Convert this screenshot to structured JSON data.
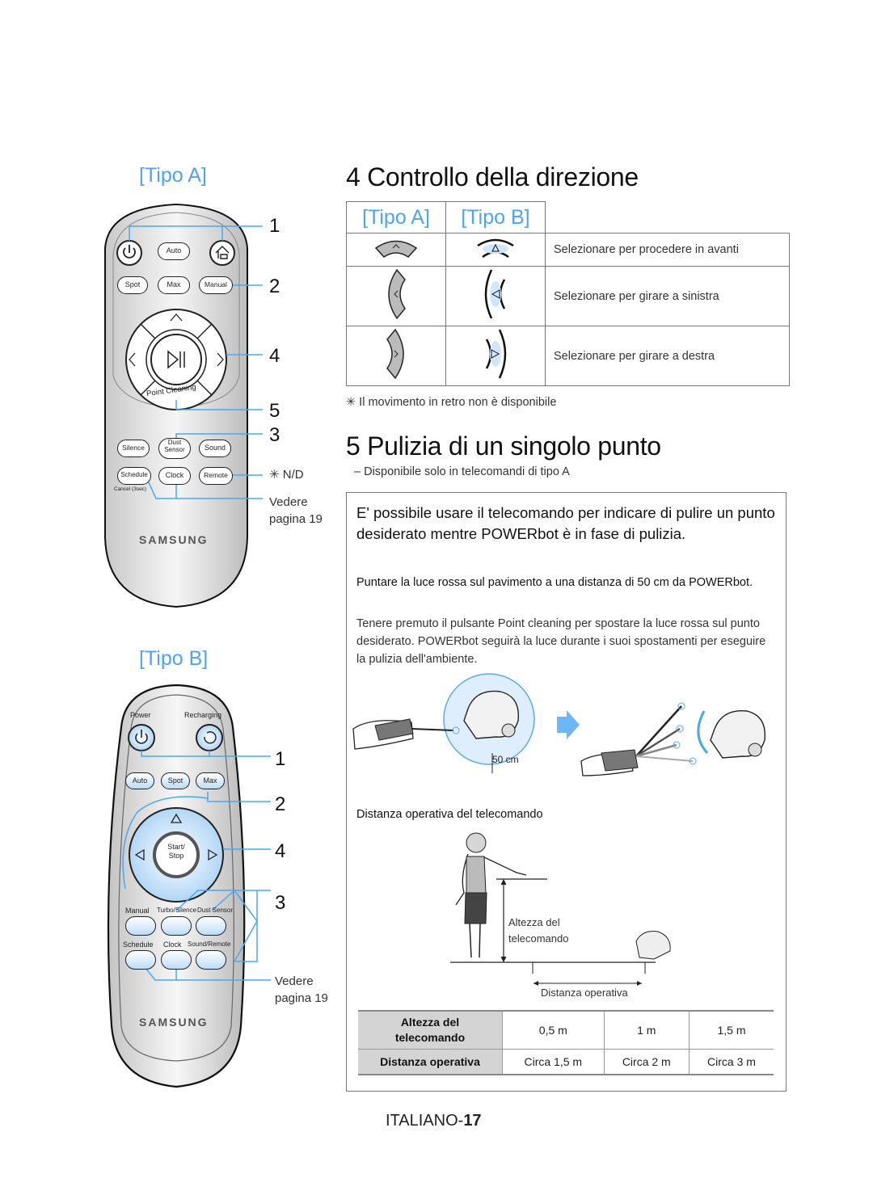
{
  "left": {
    "tipo_a_title": "[Tipo A]",
    "tipo_b_title": "[Tipo B]",
    "remote_a": {
      "buttons": {
        "power": "power-icon",
        "auto": "Auto",
        "recharge": "home-recharge-icon",
        "spot": "Spot",
        "max": "Max",
        "manual": "Manual",
        "play_pause": "play-pause-icon",
        "point_cleaning": "Point Cleaning",
        "silence": "Silence",
        "dust_sensor_1": "Dust",
        "dust_sensor_2": "Sensor",
        "sound": "Sound",
        "schedule": "Schedule",
        "cancel": "Cancel (3sec)",
        "clock": "Clock",
        "remote": "Remote",
        "brand": "SAMSUNG"
      },
      "callouts": {
        "c1": "1",
        "c2": "2",
        "c4": "4",
        "c5": "5",
        "c3": "3",
        "nd": "✳ N/D",
        "vedere_1": "Vedere",
        "vedere_2": "pagina 19"
      }
    },
    "remote_b": {
      "labels": {
        "power": "Power",
        "recharging": "Recharging",
        "auto": "Auto",
        "spot": "Spot",
        "max": "Max",
        "start_1": "Start/",
        "start_2": "Stop",
        "manual": "Manual",
        "turbo": "Turbo/Silence",
        "dust": "Dust Sensor",
        "schedule": "Schedule",
        "clock": "Clock",
        "sound_remote": "Sound/Remote",
        "brand": "SAMSUNG"
      },
      "callouts": {
        "c1": "1",
        "c2": "2",
        "c4": "4",
        "c3": "3",
        "vedere_1": "Vedere",
        "vedere_2": "pagina 19"
      }
    }
  },
  "section4": {
    "title": "4 Controllo della direzione",
    "table": {
      "headers": [
        "[Tipo A]",
        "[Tipo B]"
      ],
      "rows": [
        {
          "icon_a": "forward-arrow-icon",
          "icon_b": "forward-triangle-icon",
          "text": "Selezionare per procedere in avanti"
        },
        {
          "icon_a": "left-arrow-icon",
          "icon_b": "left-triangle-icon",
          "text": "Selezionare per girare a sinistra"
        },
        {
          "icon_a": "right-arrow-icon",
          "icon_b": "right-triangle-icon",
          "text": "Selezionare per girare a destra"
        }
      ]
    },
    "note": "✳ Il movimento in retro non è disponibile"
  },
  "section5": {
    "title": "5 Pulizia di un singolo punto",
    "subtitle": "–  Disponibile solo in telecomandi di tipo A",
    "lead": "E' possibile usare il telecomando per indicare di pulire un punto desiderato mentre POWERbot è in fase di pulizia.",
    "bold_instruction": "Puntare la luce rossa sul pavimento a una distanza di 50 cm da POWERbot.",
    "body": "Tenere premuto il pulsante Point cleaning per spostare la luce rossa sul punto desiderato. POWERbot seguirà la luce durante i suoi spostamenti per eseguire la pulizia dell'ambiente.",
    "illustration": {
      "distance_label": "50 cm"
    },
    "range_title": "Distanza operativa del telecomando",
    "diagram": {
      "height_label_1": "Altezza del",
      "height_label_2": "telecomando",
      "distance_label": "Distanza operativa"
    },
    "range_table": {
      "row1_header_1": "Altezza del",
      "row1_header_2": "telecomando",
      "row1_values": [
        "0,5 m",
        "1 m",
        "1,5 m"
      ],
      "row2_header": "Distanza operativa",
      "row2_values": [
        "Circa 1,5 m",
        "Circa 2 m",
        "Circa 3 m"
      ]
    }
  },
  "footer": {
    "lang": "ITALIANO-",
    "page": "17"
  },
  "colors": {
    "accent": "#4da3f5",
    "callout_line": "#4aa8ee",
    "table_header_bg": "#d4d4d4"
  }
}
